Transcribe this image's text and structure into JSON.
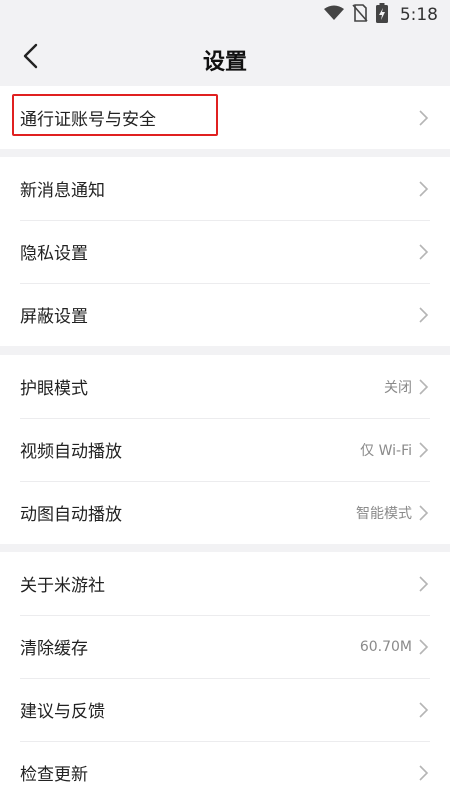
{
  "status_bar": {
    "time": "5:18",
    "icons": [
      "wifi-icon",
      "no-sim-icon",
      "battery-charging-icon"
    ]
  },
  "header": {
    "title": "设置",
    "back_icon": "back-chevron-icon"
  },
  "groups": [
    {
      "items": [
        {
          "label": "通行证账号与安全",
          "value": ""
        }
      ]
    },
    {
      "items": [
        {
          "label": "新消息通知",
          "value": ""
        },
        {
          "label": "隐私设置",
          "value": ""
        },
        {
          "label": "屏蔽设置",
          "value": ""
        }
      ]
    },
    {
      "items": [
        {
          "label": "护眼模式",
          "value": "关闭"
        },
        {
          "label": "视频自动播放",
          "value": "仅 Wi-Fi"
        },
        {
          "label": "动图自动播放",
          "value": "智能模式"
        }
      ]
    },
    {
      "items": [
        {
          "label": "关于米游社",
          "value": ""
        },
        {
          "label": "清除缓存",
          "value": "60.70M"
        },
        {
          "label": "建议与反馈",
          "value": ""
        },
        {
          "label": "检查更新",
          "value": ""
        }
      ]
    }
  ],
  "highlight_color": "#e02020"
}
